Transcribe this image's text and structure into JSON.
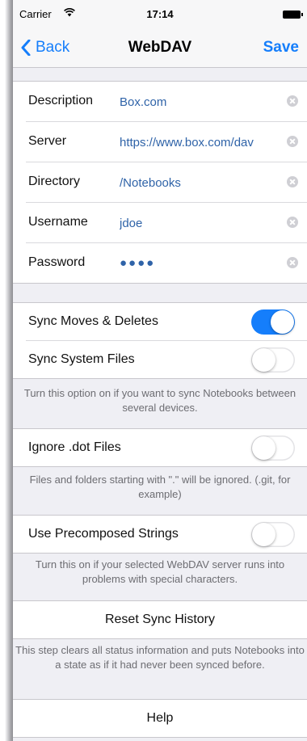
{
  "status_bar": {
    "carrier": "Carrier",
    "time": "17:14"
  },
  "nav": {
    "back_label": "Back",
    "title": "WebDAV",
    "save_label": "Save"
  },
  "form": {
    "rows": [
      {
        "label": "Description",
        "value": "Box.com"
      },
      {
        "label": "Server",
        "value": "https://www.box.com/dav"
      },
      {
        "label": "Directory",
        "value": "/Notebooks"
      },
      {
        "label": "Username",
        "value": "jdoe"
      },
      {
        "label": "Password",
        "value": "●●●●"
      }
    ]
  },
  "settings": {
    "sync_moves_deletes": {
      "label": "Sync Moves & Deletes",
      "on": true
    },
    "sync_system_files": {
      "label": "Sync System Files",
      "on": false,
      "note": "Turn this option on if you want to sync Notebooks between several devices."
    },
    "ignore_dot_files": {
      "label": "Ignore .dot Files",
      "on": false,
      "note": "Files and folders starting with \".\" will be ignored. (.git, for example)"
    },
    "use_precomposed_strings": {
      "label": "Use Precomposed Strings",
      "on": false,
      "note": "Turn this on if your selected WebDAV server runs into problems with special characters."
    }
  },
  "reset_sync_history": {
    "label": "Reset Sync History",
    "note": "This step clears all status information and puts Notebooks into a state as if it had never been synced before."
  },
  "help": {
    "label": "Help"
  },
  "colors": {
    "accent": "#157efb",
    "value_text": "#2f63a8",
    "group_bg": "#efeff4"
  }
}
